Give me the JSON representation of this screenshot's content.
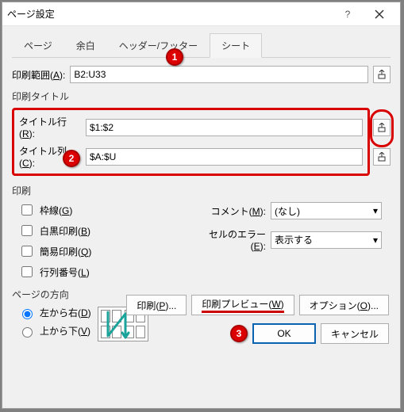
{
  "window": {
    "title": "ページ設定"
  },
  "tabs": {
    "page": "ページ",
    "margins": "余白",
    "headerfooter": "ヘッダー/フッター",
    "sheet": "シート"
  },
  "printArea": {
    "label": "印刷範囲(",
    "accel": "A",
    "labelEnd": "):",
    "value": "B2:U33"
  },
  "printTitles": {
    "label": "印刷タイトル"
  },
  "titleRows": {
    "label": "タイトル行(",
    "accel": "R",
    "labelEnd": "):",
    "value": "$1:$2"
  },
  "titleCols": {
    "label": "タイトル列(",
    "accel": "C",
    "labelEnd": "):",
    "value": "$A:$U"
  },
  "printSection": {
    "label": "印刷"
  },
  "gridlines": {
    "label": "枠線(",
    "accel": "G",
    "labelEnd": ")"
  },
  "bw": {
    "label": "白黒印刷(",
    "accel": "B",
    "labelEnd": ")"
  },
  "draft": {
    "label": "簡易印刷(",
    "accel": "Q",
    "labelEnd": ")"
  },
  "rowcolhead": {
    "label": "行列番号(",
    "accel": "L",
    "labelEnd": ")"
  },
  "comments": {
    "label": "コメント(",
    "accel": "M",
    "labelEnd": "):",
    "value": "(なし)"
  },
  "cellerrors": {
    "label": "セルのエラー(",
    "accel": "E",
    "labelEnd": "):",
    "value": "表示する"
  },
  "pageOrder": {
    "label": "ページの方向"
  },
  "lr": {
    "label": "左から右(",
    "accel": "D",
    "labelEnd": ")"
  },
  "tb": {
    "label": "上から下(",
    "accel": "V",
    "labelEnd": ")"
  },
  "buttons": {
    "print": "印刷(",
    "printA": "P",
    "printEnd": ")...",
    "preview": "印刷プレビュー(",
    "previewA": "W",
    "previewEnd": ")",
    "options": "オプション(",
    "optionsA": "O",
    "optionsEnd": ")...",
    "ok": "OK",
    "cancel": "キャンセル"
  },
  "callouts": {
    "c1": "1",
    "c2": "2",
    "c3": "3"
  }
}
